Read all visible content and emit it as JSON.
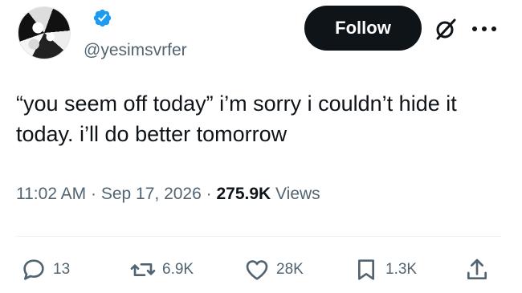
{
  "profile": {
    "handle": "@yesimsvrfer",
    "verified": true,
    "avatar_icon": "profile-photo"
  },
  "header": {
    "follow_label": "Follow",
    "grok_icon": "grok-icon",
    "more_icon": "more-icon"
  },
  "tweet": {
    "text": "“you seem off today” i’m sorry i couldn’t hide it today. i’ll do better tomorrow",
    "time": "11:02 AM",
    "date": "Sep 17, 2026",
    "views_count": "275.9K",
    "views_label": "Views"
  },
  "actions": {
    "replies": "13",
    "reposts": "6.9K",
    "likes": "28K",
    "bookmarks": "1.3K"
  },
  "colors": {
    "verified": "#1d9bf0",
    "text": "#0f1419",
    "secondary": "#536471",
    "button": "#0f1419"
  }
}
